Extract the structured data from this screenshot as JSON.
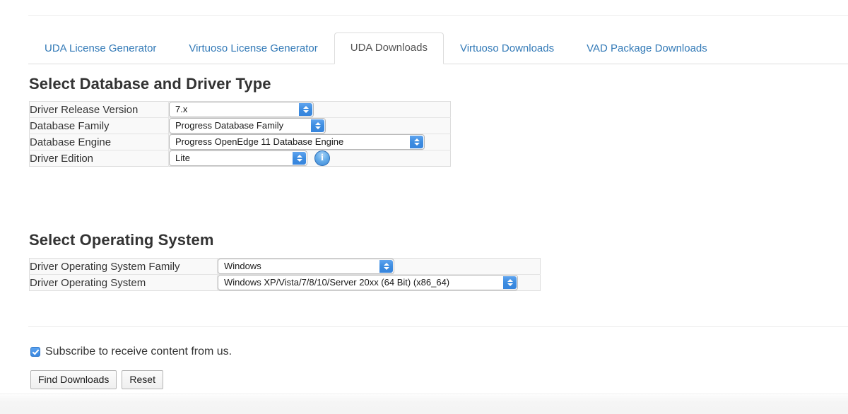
{
  "tabs": [
    {
      "label": "UDA License Generator",
      "active": false
    },
    {
      "label": "Virtuoso License Generator",
      "active": false
    },
    {
      "label": "UDA Downloads",
      "active": true
    },
    {
      "label": "Virtuoso Downloads",
      "active": false
    },
    {
      "label": "VAD Package Downloads",
      "active": false
    }
  ],
  "sections": {
    "database": {
      "heading": "Select Database and Driver Type",
      "rows": [
        {
          "label": "Driver Release Version",
          "value": "7.x"
        },
        {
          "label": "Database Family",
          "value": "Progress Database Family"
        },
        {
          "label": "Database Engine",
          "value": "Progress OpenEdge 11 Database Engine"
        },
        {
          "label": "Driver Edition",
          "value": "Lite",
          "info": "i"
        }
      ]
    },
    "operating_system": {
      "heading": "Select Operating System",
      "rows": [
        {
          "label": "Driver Operating System Family",
          "value": "Windows"
        },
        {
          "label": "Driver Operating System",
          "value": "Windows XP/Vista/7/8/10/Server 20xx (64 Bit) (x86_64)"
        }
      ]
    }
  },
  "subscribe": {
    "label": "Subscribe to receive content from us.",
    "checked": true
  },
  "buttons": {
    "find": "Find Downloads",
    "reset": "Reset"
  },
  "colors": {
    "link": "#337ab7",
    "active_tab_text": "#555555",
    "accent_blue": "#3d8ce0",
    "table_bg": "#f9f9f9",
    "border": "#dddddd"
  }
}
